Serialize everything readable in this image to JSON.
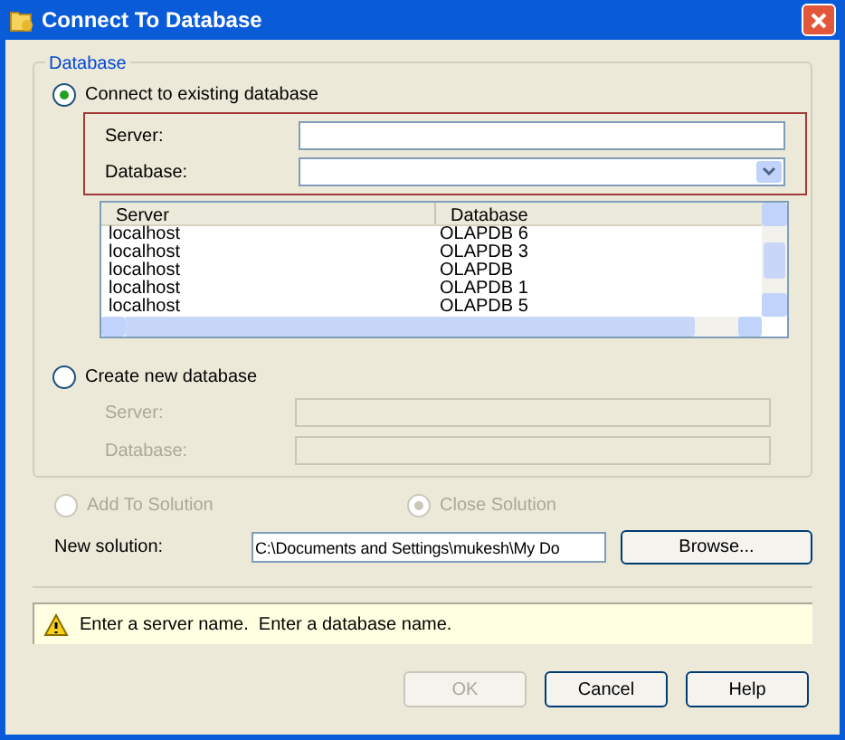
{
  "window": {
    "title": "Connect To Database"
  },
  "group": {
    "title": "Database"
  },
  "existing": {
    "label": "Connect to existing database",
    "selected": true,
    "disabled": false,
    "fields": [
      {
        "label": "Server:",
        "kind": "text"
      },
      {
        "label": "Database:",
        "kind": "combo"
      }
    ]
  },
  "list": {
    "columns": [
      "Server",
      "Database"
    ],
    "rows": [
      {
        "server": "localhost",
        "database": "OLAPDB 6"
      },
      {
        "server": "localhost",
        "database": "OLAPDB 3"
      },
      {
        "server": "localhost",
        "database": "OLAPDB"
      },
      {
        "server": "localhost",
        "database": "OLAPDB 1"
      },
      {
        "server": "localhost",
        "database": "OLAPDB 5"
      }
    ]
  },
  "create": {
    "label": "Create new database",
    "selected": false,
    "disabled": false,
    "fields": [
      {
        "label": "Server:",
        "kind": "text",
        "disabled": true
      },
      {
        "label": "Database:",
        "kind": "text",
        "disabled": true
      }
    ]
  },
  "solution_options": [
    {
      "label": "Add To Solution",
      "selected": false,
      "disabled": true
    },
    {
      "label": "Close Solution",
      "selected": true,
      "disabled": true
    }
  ],
  "new_solution": {
    "label": "New solution:",
    "value": "C:\\Documents and Settings\\mukesh\\My Do",
    "button": "Browse..."
  },
  "message": {
    "text": "Enter a server name.  Enter a database name."
  },
  "buttons": [
    {
      "label": "OK",
      "disabled": true
    },
    {
      "label": "Cancel",
      "disabled": false
    },
    {
      "label": "Help",
      "disabled": false
    }
  ]
}
